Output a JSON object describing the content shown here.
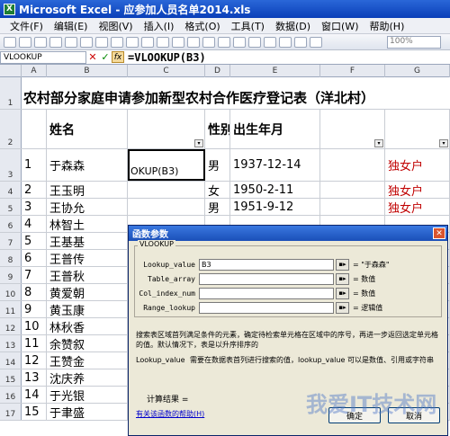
{
  "titlebar": {
    "title": "Microsoft Excel - 应参加人员名单2014.xls"
  },
  "menubar": {
    "items": [
      "文件(F)",
      "编辑(E)",
      "视图(V)",
      "插入(I)",
      "格式(O)",
      "工具(T)",
      "数据(D)",
      "窗口(W)",
      "帮助(H)"
    ]
  },
  "toolbar": {
    "zoom": "100%"
  },
  "formula_bar": {
    "name_box": "VLOOKUP",
    "cancel": "✕",
    "enter": "✓",
    "fx": "fx",
    "formula": "=VLOOKUP(B3)"
  },
  "columns": [
    "A",
    "B",
    "C",
    "D",
    "E",
    "F",
    "G"
  ],
  "sheet": {
    "title": "农村部分家庭申请参加新型农村合作医疗登记表（洋北村）",
    "header": {
      "name": "姓名",
      "sex": "性别",
      "birth": "出生年月"
    },
    "row3_c": "OKUP(B3)",
    "rows": [
      {
        "rn": "3",
        "a": "1",
        "b": "于森森",
        "d": "男",
        "e": "1937-12-14",
        "g": "独女户"
      },
      {
        "rn": "4",
        "a": "2",
        "b": "王玉明",
        "d": "女",
        "e": "1950-2-11",
        "g": "独女户"
      },
      {
        "rn": "5",
        "a": "3",
        "b": "王协允",
        "d": "男",
        "e": "1951-9-12",
        "g": "独女户"
      },
      {
        "rn": "6",
        "a": "4",
        "b": "林智土",
        "d": "",
        "e": "",
        "g": ""
      },
      {
        "rn": "7",
        "a": "5",
        "b": "王基基",
        "d": "",
        "e": "",
        "g": ""
      },
      {
        "rn": "8",
        "a": "6",
        "b": "王普传",
        "d": "",
        "e": "",
        "g": ""
      },
      {
        "rn": "9",
        "a": "7",
        "b": "王普秋",
        "d": "",
        "e": "",
        "g": ""
      },
      {
        "rn": "10",
        "a": "8",
        "b": "黄爱朝",
        "d": "",
        "e": "",
        "g": ""
      },
      {
        "rn": "11",
        "a": "9",
        "b": "黄玉康",
        "d": "",
        "e": "",
        "g": ""
      },
      {
        "rn": "12",
        "a": "10",
        "b": "林秋香",
        "d": "",
        "e": "",
        "g": ""
      },
      {
        "rn": "13",
        "a": "11",
        "b": "余赞叙",
        "d": "",
        "e": "",
        "g": ""
      },
      {
        "rn": "14",
        "a": "12",
        "b": "王赞金",
        "d": "",
        "e": "",
        "g": ""
      },
      {
        "rn": "15",
        "a": "13",
        "b": "沈庆养",
        "d": "",
        "e": "",
        "g": ""
      },
      {
        "rn": "16",
        "a": "14",
        "b": "于光银",
        "d": "",
        "e": "",
        "g": ""
      },
      {
        "rn": "17",
        "a": "15",
        "b": "于聿盛",
        "d": "",
        "e": "",
        "g": ""
      }
    ]
  },
  "dialog": {
    "title": "函数参数",
    "close": "✕",
    "function_name": "VLOOKUP",
    "args": [
      {
        "label": "Lookup_value",
        "value": "B3",
        "result": "= \"于森森\""
      },
      {
        "label": "Table_array",
        "value": "",
        "result": "= 数值"
      },
      {
        "label": "Col_index_num",
        "value": "",
        "result": "= 数值"
      },
      {
        "label": "Range_lookup",
        "value": "",
        "result": "= 逻辑值"
      }
    ],
    "description": "搜索表区域首列满足条件的元素，确定待检索单元格在区域中的序号，再进一步返回选定单元格的值。默认情况下，表是以升序排序的",
    "arg_name": "Lookup_value",
    "arg_description": "需要在数据表首列进行搜索的值，lookup_value 可以是数值、引用或字符串",
    "calc_label": "计算结果 =",
    "help_link": "有关该函数的帮助(H)",
    "ok": "确定",
    "cancel": "取消"
  },
  "watermark": "我爱IT技术网"
}
